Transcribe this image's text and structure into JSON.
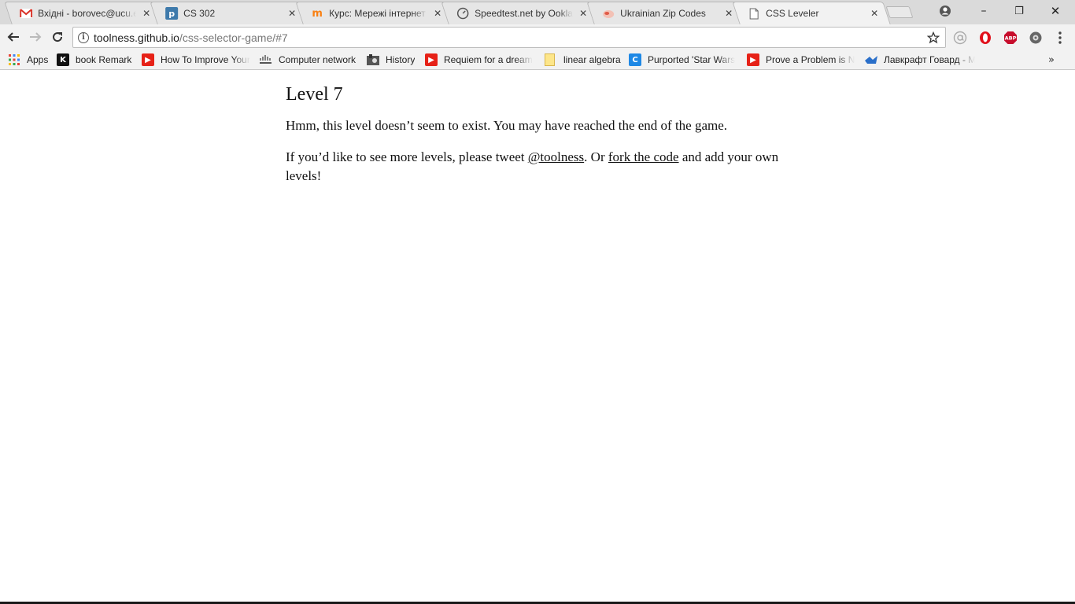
{
  "tabs": [
    {
      "title": "Вхідні - borovec@ucu.e",
      "icon": "gmail-icon",
      "color": "#d93025"
    },
    {
      "title": "CS 302",
      "icon": "piazza-icon",
      "color": "#3e7aab"
    },
    {
      "title": "Курс: Мережі інтернет",
      "icon": "moodle-icon",
      "color": "#f98012"
    },
    {
      "title": "Speedtest.net by Ookla",
      "icon": "speedtest-icon",
      "color": "#555555"
    },
    {
      "title": "Ukrainian Zip Codes",
      "icon": "zip-codes-icon",
      "color": "#e05a47"
    },
    {
      "title": "CSS Leveler",
      "icon": "page-icon",
      "color": "#666666",
      "active": true
    }
  ],
  "window_controls": {
    "minimize": "–",
    "restore": "❐",
    "close": "✕"
  },
  "address_bar": {
    "host": "toolness.github.io",
    "path": "/css-selector-game/#7"
  },
  "bookmarks": [
    {
      "label": "Apps",
      "icon": "apps-grid-icon"
    },
    {
      "label": "book Remark",
      "icon": "k-icon"
    },
    {
      "label": "How To Improve Your",
      "icon": "youtube-icon"
    },
    {
      "label": "Computer network",
      "icon": "cisco-icon"
    },
    {
      "label": "History",
      "icon": "bookmark-history-icon"
    },
    {
      "label": "Requiem for a dream",
      "icon": "youtube-icon"
    },
    {
      "label": "linear algebra",
      "icon": "folder-icon"
    },
    {
      "label": "Purported 'Star Wars",
      "icon": "c-icon"
    },
    {
      "label": "Prove a Problem is N",
      "icon": "youtube-icon"
    },
    {
      "label": "Лавкрафт Говард - М",
      "icon": "vk-icon"
    }
  ],
  "page": {
    "heading": "Level 7",
    "paragraph1": "Hmm, this level doesn’t seem to exist. You may have reached the end of the game.",
    "paragraph2_before": "If you’d like to see more levels, please tweet ",
    "twitter_link": "@toolness",
    "paragraph2_middle": ". Or ",
    "fork_link": "fork the code",
    "paragraph2_after": " and add your own levels!"
  },
  "colors": {
    "youtube": "#e62117",
    "chrome_bg": "#f2f2f2",
    "tab_bg": "#e6e6e6"
  }
}
